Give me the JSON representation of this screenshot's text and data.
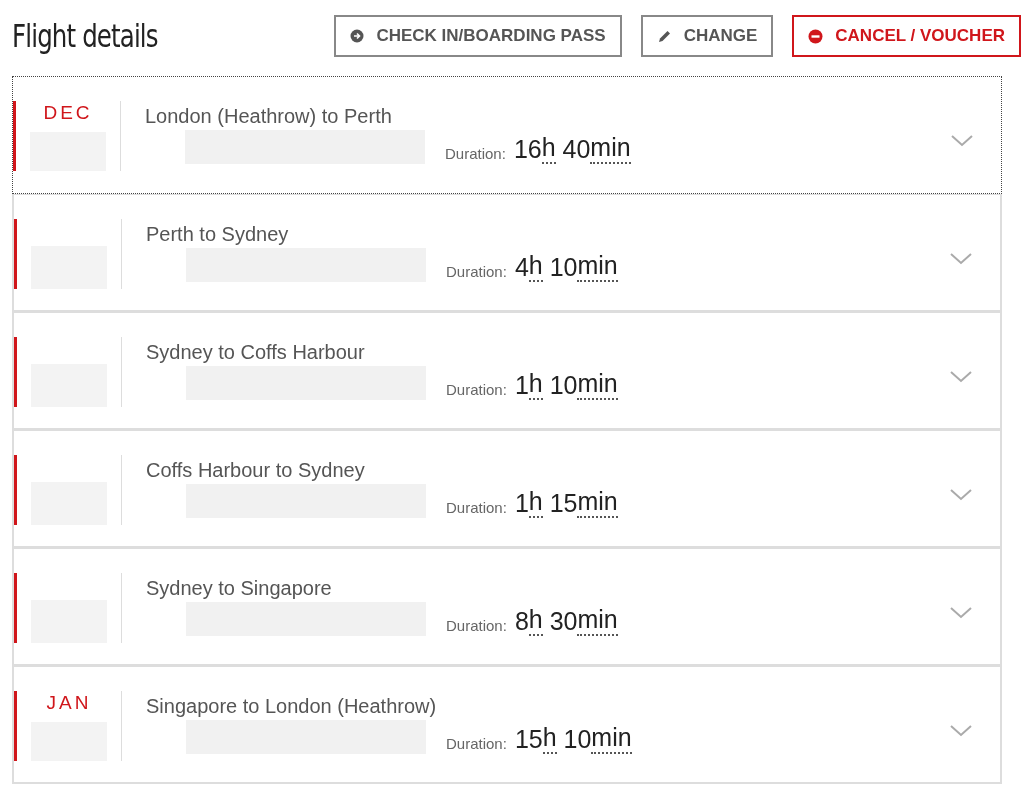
{
  "title": "Flight details",
  "actions": [
    {
      "kind": "boarding",
      "label": "CHECK IN/BOARDING PASS"
    },
    {
      "kind": "change",
      "label": "CHANGE"
    },
    {
      "kind": "cancel",
      "label": "CANCEL / VOUCHER"
    }
  ],
  "flights": [
    {
      "month": "DEC",
      "route": "London (Heathrow) to Perth",
      "duration_label": "Duration:",
      "hours": "16",
      "hours_unit": "h",
      "minutes": "40",
      "minutes_unit": "min",
      "focused": true
    },
    {
      "route": "Perth to Sydney",
      "duration_label": "Duration:",
      "hours": "4",
      "hours_unit": "h",
      "minutes": "10",
      "minutes_unit": "min",
      "focused": false
    },
    {
      "route": "Sydney to Coffs Harbour",
      "duration_label": "Duration:",
      "hours": "1",
      "hours_unit": "h",
      "minutes": "10",
      "minutes_unit": "min",
      "focused": false
    },
    {
      "route": "Coffs Harbour to Sydney",
      "duration_label": "Duration:",
      "hours": "1",
      "hours_unit": "h",
      "minutes": "15",
      "minutes_unit": "min",
      "focused": false
    },
    {
      "route": "Sydney to Singapore",
      "duration_label": "Duration:",
      "hours": "8",
      "hours_unit": "h",
      "minutes": "30",
      "minutes_unit": "min",
      "focused": false
    },
    {
      "month": "JAN",
      "route": "Singapore to London (Heathrow)",
      "duration_label": "Duration:",
      "hours": "15",
      "hours_unit": "h",
      "minutes": "10",
      "minutes_unit": "min",
      "focused": false
    }
  ]
}
